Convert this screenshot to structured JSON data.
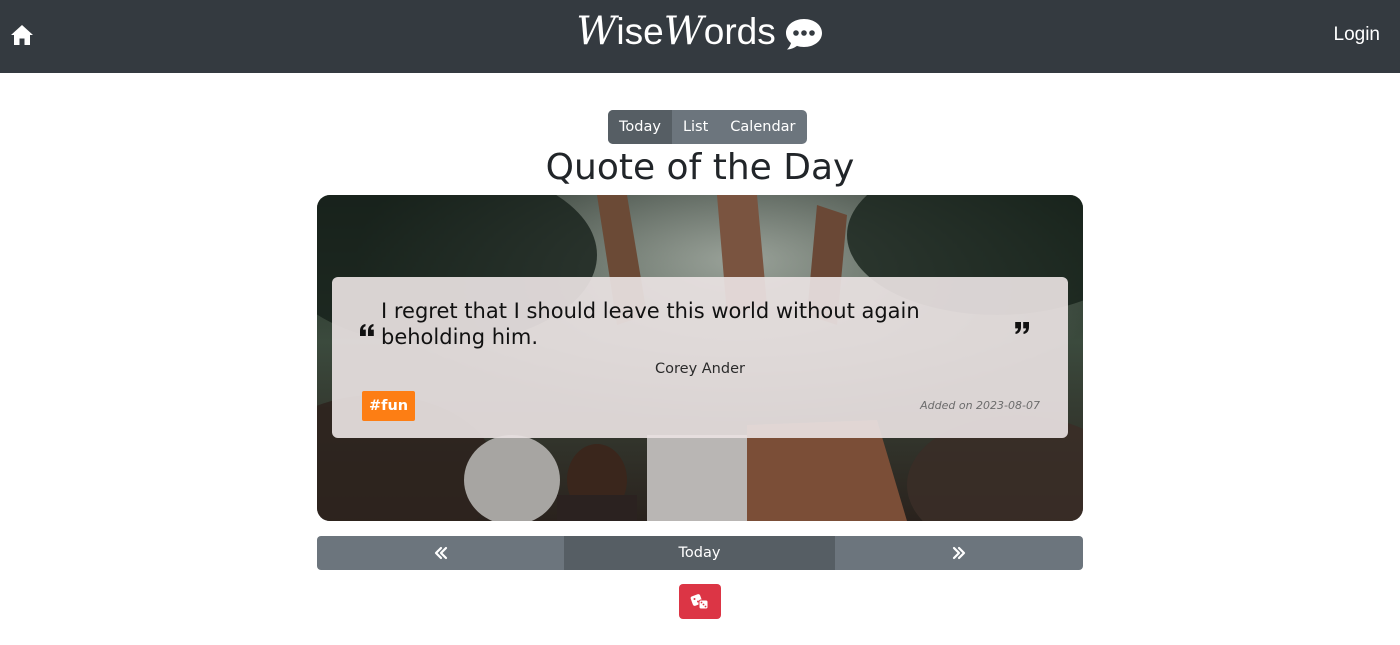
{
  "navbar": {
    "brand_part1": "Wise",
    "brand_part2": "Words",
    "login_label": "Login",
    "home_icon": "home-icon",
    "brand_icon": "speech-bubble-icon"
  },
  "view_tabs": [
    {
      "label": "Today",
      "active": true
    },
    {
      "label": "List",
      "active": false
    },
    {
      "label": "Calendar",
      "active": false
    }
  ],
  "page_title": "Quote of the Day",
  "quote": {
    "text": "I regret that I should leave this world without again beholding him.",
    "author": "Corey Ander",
    "tag": "#fun",
    "added": "Added on 2023-08-07"
  },
  "pager": {
    "prev_icon": "double-chevron-left-icon",
    "today_label": "Today",
    "next_icon": "double-chevron-right-icon"
  },
  "random_button": {
    "icon": "dice-icon"
  },
  "colors": {
    "navbar": "#343a40",
    "secondary": "#6c757d",
    "secondary_active": "#565e64",
    "tag": "#fd7e14",
    "random": "#dc3545"
  }
}
